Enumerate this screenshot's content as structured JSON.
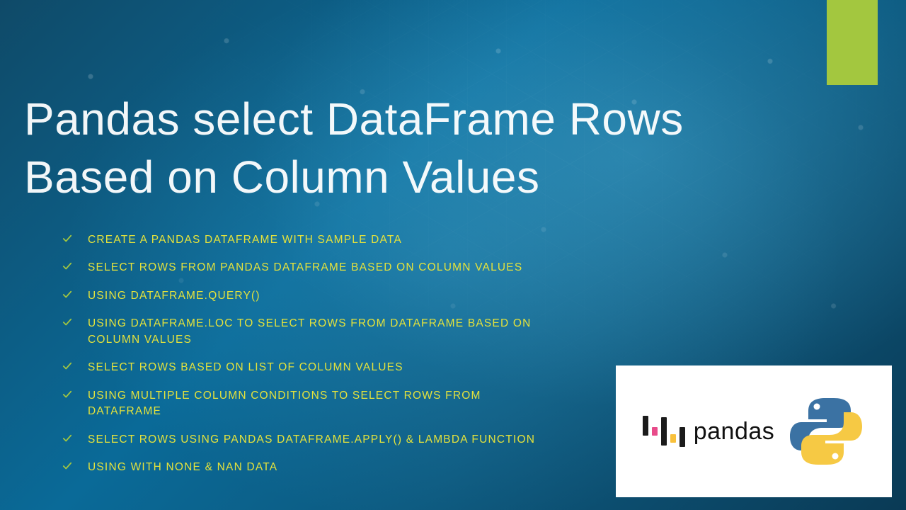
{
  "title_line1": "Pandas select DataFrame Rows",
  "title_line2": "Based on Column Values",
  "accent_color": "#a3c73f",
  "bullets": [
    "CREATE A PANDAS DATAFRAME WITH SAMPLE DATA",
    "SELECT ROWS FROM PANDAS DATAFRAME BASED ON COLUMN VALUES",
    "USING DATAFRAME.QUERY()",
    "USING DATAFRAME.LOC TO SELECT ROWS FROM DATAFRAME BASED ON COLUMN VALUES",
    " SELECT ROWS BASED ON LIST OF COLUMN VALUES",
    "USING MULTIPLE COLUMN CONDITIONS TO SELECT ROWS FROM DATAFRAME",
    "SELECT ROWS USING PANDAS DATAFRAME.APPLY() & LAMBDA FUNCTION",
    "USING WITH NONE & NAN DATA"
  ],
  "logo": {
    "pandas_label": "pandas"
  }
}
